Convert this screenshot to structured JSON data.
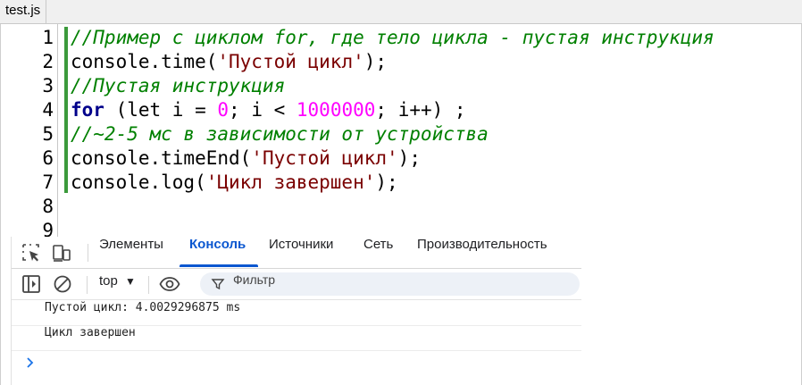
{
  "editor": {
    "tab_label": "test.js",
    "lines": [
      {
        "num": "1",
        "tokens": [
          {
            "t": "//Пример с циклом for, где тело цикла - пустая инструкция",
            "c": "cmt"
          }
        ]
      },
      {
        "num": "2",
        "tokens": [
          {
            "t": "console.time(",
            "c": ""
          },
          {
            "t": "'Пустой цикл'",
            "c": "str"
          },
          {
            "t": ");",
            "c": ""
          }
        ]
      },
      {
        "num": "3",
        "tokens": [
          {
            "t": "//Пустая инструкция",
            "c": "cmt"
          }
        ]
      },
      {
        "num": "4",
        "tokens": [
          {
            "t": "for",
            "c": "kw"
          },
          {
            "t": " (let i = ",
            "c": ""
          },
          {
            "t": "0",
            "c": "num"
          },
          {
            "t": "; i < ",
            "c": ""
          },
          {
            "t": "1000000",
            "c": "num"
          },
          {
            "t": "; i++) ;",
            "c": ""
          }
        ]
      },
      {
        "num": "5",
        "tokens": [
          {
            "t": "//~2-5 мс в зависимости от устройства",
            "c": "cmt"
          }
        ]
      },
      {
        "num": "6",
        "tokens": [
          {
            "t": "console.timeEnd(",
            "c": ""
          },
          {
            "t": "'Пустой цикл'",
            "c": "str"
          },
          {
            "t": ");",
            "c": ""
          }
        ]
      },
      {
        "num": "7",
        "tokens": [
          {
            "t": "console.log(",
            "c": ""
          },
          {
            "t": "'Цикл завершен'",
            "c": "str"
          },
          {
            "t": ");",
            "c": ""
          }
        ]
      },
      {
        "num": "8",
        "tokens": []
      },
      {
        "num": "9",
        "tokens": []
      }
    ]
  },
  "devtools": {
    "tabs": [
      {
        "label": "Элементы",
        "active": false
      },
      {
        "label": "Консоль",
        "active": true
      },
      {
        "label": "Источники",
        "active": false
      },
      {
        "label": "Сеть",
        "active": false
      },
      {
        "label": "Производительность",
        "active": false
      }
    ],
    "toolbar": {
      "context": "top",
      "filter_placeholder": "Фильтр"
    },
    "console_messages": [
      "Пустой цикл: 4.0029296875 ms",
      "Цикл завершен"
    ],
    "icons": {
      "inspect": "inspect-element-icon",
      "device": "device-toggle-icon",
      "sidebar": "sidebar-toggle-icon",
      "clear": "clear-console-icon",
      "eye": "live-expression-eye-icon",
      "filter": "filter-funnel-icon",
      "prompt": "chevron-right-icon"
    },
    "colors": {
      "accent": "#0b57d0",
      "comment": "#008000",
      "string": "#7a0000",
      "number": "#ff00ff",
      "keyword": "#00008b"
    }
  }
}
